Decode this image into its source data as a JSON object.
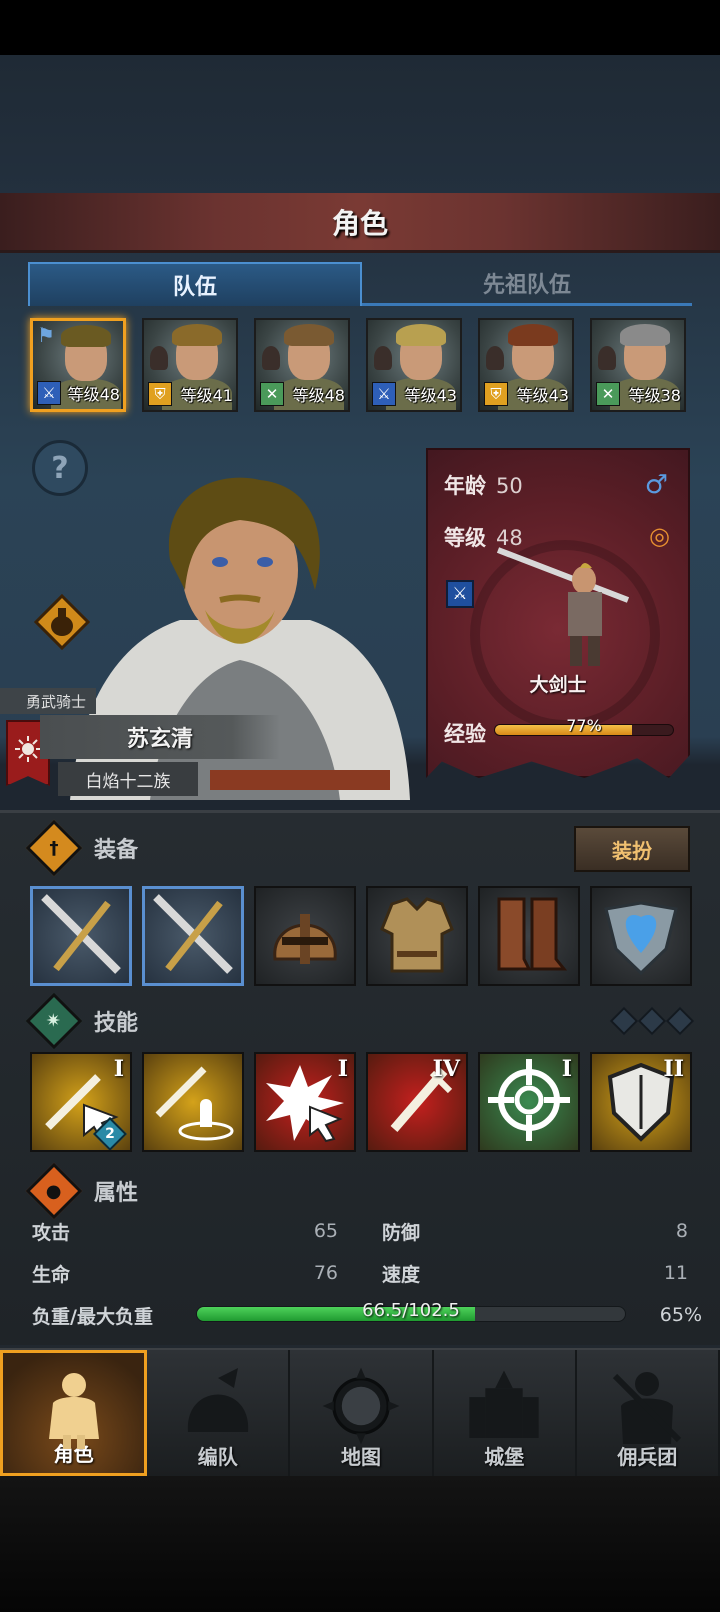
{
  "header": {
    "title": "角色"
  },
  "tabs": [
    {
      "label": "队伍",
      "active": true
    },
    {
      "label": "先祖队伍",
      "active": false
    }
  ],
  "team": [
    {
      "level": "等级48",
      "role_icon": "sword-icon",
      "role_color": "#2e5fb8",
      "hair": "#6a5a22",
      "selected": true
    },
    {
      "level": "等级41",
      "role_icon": "shield-icon",
      "role_color": "#e0a020",
      "hair": "#8a6a2a",
      "selected": false
    },
    {
      "level": "等级48",
      "role_icon": "cross-bow-icon",
      "role_color": "#4a9a5a",
      "hair": "#7a5a32",
      "selected": false
    },
    {
      "level": "等级43",
      "role_icon": "sword-icon",
      "role_color": "#2e5fb8",
      "hair": "#b8a050",
      "selected": false
    },
    {
      "level": "等级43",
      "role_icon": "shield-icon",
      "role_color": "#e0a020",
      "hair": "#7a3a1e",
      "selected": false
    },
    {
      "level": "等级38",
      "role_icon": "cross-bow-icon",
      "role_color": "#4a9a5a",
      "hair": "#8a8a8a",
      "selected": false
    }
  ],
  "hero": {
    "title": "勇武骑士",
    "name": "苏玄清",
    "clan": "白焰十二族"
  },
  "info": {
    "age_label": "年龄",
    "age": "50",
    "level_label": "等级",
    "level": "48",
    "class_name": "大剑士",
    "xp_label": "经验",
    "xp_text": "77%",
    "xp_fraction": 0.77
  },
  "equipment": {
    "label": "装备",
    "dress_button": "装扮",
    "slots": [
      "sword-icon",
      "sword-icon",
      "helmet-icon",
      "armor-icon",
      "boots-icon",
      "amulet-icon"
    ]
  },
  "skills": {
    "label": "技能",
    "items": [
      {
        "icon": "sword-strike-icon",
        "tier": "I",
        "bg": "#d4a21a",
        "badge": "2"
      },
      {
        "icon": "sword-aura-icon",
        "tier": "",
        "bg": "#d4a21a",
        "badge": ""
      },
      {
        "icon": "burst-icon",
        "tier": "I",
        "bg": "#c4201e",
        "badge": ""
      },
      {
        "icon": "sword-down-icon",
        "tier": "IV",
        "bg": "#c4201e",
        "badge": ""
      },
      {
        "icon": "target-icon",
        "tier": "I",
        "bg": "#3a8a50",
        "badge": ""
      },
      {
        "icon": "shield-icon",
        "tier": "II",
        "bg": "#d4a21a",
        "badge": ""
      }
    ]
  },
  "attributes": {
    "label": "属性",
    "attack_label": "攻击",
    "attack": "65",
    "defense_label": "防御",
    "defense": "8",
    "health_label": "生命",
    "health": "76",
    "speed_label": "速度",
    "speed": "11",
    "load_label": "负重/最大负重",
    "load_text": "66.5/102.5",
    "load_percent": "65%",
    "load_fraction": 0.65
  },
  "nav": [
    {
      "label": "角色",
      "icon": "knight-icon",
      "active": true
    },
    {
      "label": "编队",
      "icon": "helmet-icon",
      "active": false
    },
    {
      "label": "地图",
      "icon": "compass-icon",
      "active": false
    },
    {
      "label": "城堡",
      "icon": "castle-icon",
      "active": false
    },
    {
      "label": "佣兵团",
      "icon": "mercenary-icon",
      "active": false
    }
  ]
}
